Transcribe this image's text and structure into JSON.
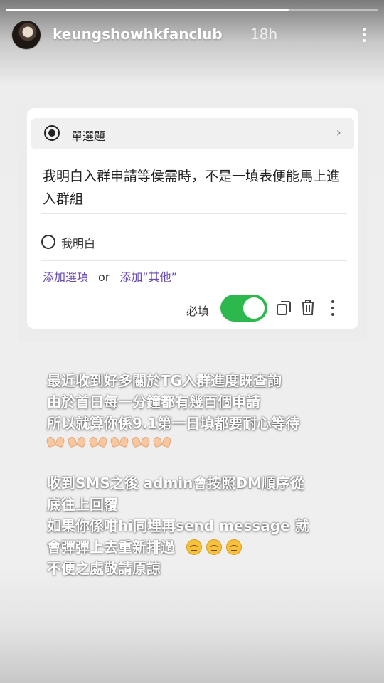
{
  "story": {
    "username": "keungshowhkfanclub",
    "time": "18h",
    "progress": 0.76
  },
  "form": {
    "question_type": "單選題",
    "question_text": "我明白入群申請等侯需時，不是一填表便能馬上進入群組",
    "option_label": "我明白",
    "add_option": "添加選項",
    "or_text": "or",
    "add_other": "添加“其他”",
    "required_label": "必填",
    "required_on": true
  },
  "caption": {
    "paragraph1": "最近收到好多關於TG入群進度既查詢\n由於首日每一分鐘都有幾百個申請\n所以就算你係9.1第一日填都要耐心等待",
    "paragraph2": "收到SMS之後 admin會按照DM順序從\n底往上回覆\n如果你係咁hi同埋再send message 就\n會彈彈上去重新排過\n不便之處敬請原諒",
    "hands_emoji_count": 6,
    "face_emoji_count": 3
  },
  "icons": {
    "more": "more-vertical-icon",
    "copy": "copy-icon",
    "trash": "trash-icon"
  },
  "colors": {
    "toggle_on": "#2db84d",
    "link_purple": "#6a4cb0"
  }
}
